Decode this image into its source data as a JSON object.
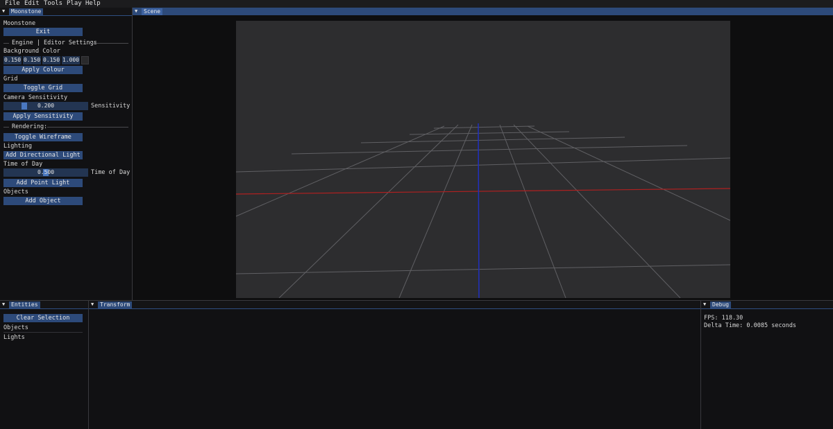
{
  "menubar": {
    "items": [
      "File",
      "Edit",
      "Tools",
      "Play",
      "Help"
    ]
  },
  "moonstone_panel": {
    "tab_label": "Moonstone",
    "title": "Moonstone",
    "exit_label": "Exit",
    "engine_section": "Engine | Editor Settings",
    "background_color_label": "Background Color",
    "bg_values": [
      "0.150",
      "0.150",
      "0.150",
      "1.000"
    ],
    "apply_colour_label": "Apply Colour",
    "grid_label": "Grid",
    "toggle_grid_label": "Toggle Grid",
    "camera_sensitivity_label": "Camera Sensitivity",
    "sensitivity_value": "0.200",
    "sensitivity_fraction": 0.1,
    "sensitivity_side_label": "Sensitivity",
    "apply_sensitivity_label": "Apply Sensitivity",
    "rendering_section": "Rendering:",
    "toggle_wireframe_label": "Toggle Wireframe",
    "lighting_label": "Lighting",
    "add_directional_light_label": "Add Directional Light",
    "time_of_day_label": "Time of Day",
    "time_of_day_value": "0.500",
    "time_of_day_fraction": 0.5,
    "time_of_day_side_label": "Time of Day",
    "add_point_light_label": "Add Point Light",
    "objects_label": "Objects",
    "add_object_label": "Add Object"
  },
  "scene_panel": {
    "tab_label": "Scene"
  },
  "entities_panel": {
    "tab_label": "Entities",
    "clear_selection_label": "Clear Selection",
    "items": [
      "Objects",
      "Lights"
    ]
  },
  "transform_panel": {
    "tab_label": "Transform"
  },
  "debug_panel": {
    "tab_label": "Debug",
    "fps": "FPS: 118.30",
    "delta_time": "Delta Time: 0.0085 seconds"
  },
  "colors": {
    "accent": "#2d4a7a",
    "background": "#0f0f10",
    "viewport": "#2d2d2f",
    "axis_x": "#b02020",
    "axis_z": "#2030c0",
    "grid": "#6a6a6e"
  }
}
